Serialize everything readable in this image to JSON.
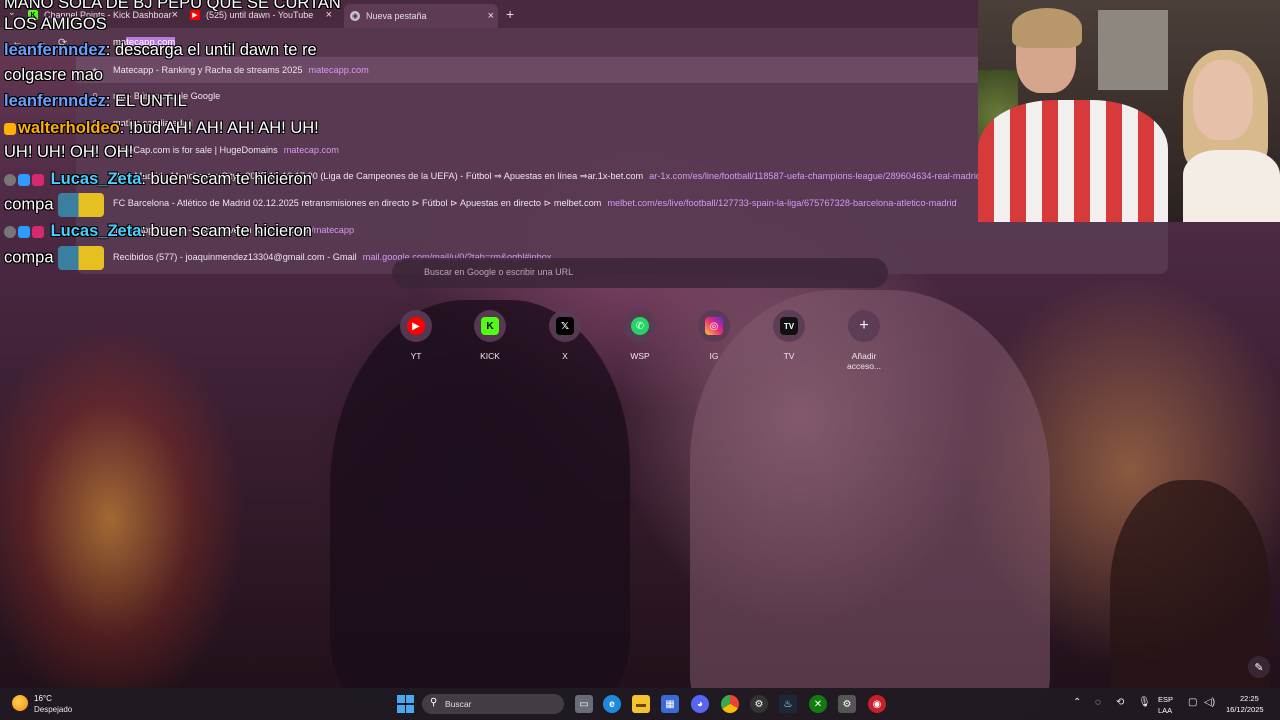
{
  "browser": {
    "tabs": [
      {
        "title": "Channel Points - Kick Dashboar",
        "favicon": "kick-icon",
        "active": false
      },
      {
        "title": "(525) until dawn - YouTube",
        "favicon": "youtube-icon",
        "active": false
      },
      {
        "title": "Nueva pestaña",
        "favicon": "chrome-icon",
        "active": true
      }
    ],
    "new_tab_symbol": "+",
    "omnibox": {
      "typed": "ma",
      "autocomplete": "tecapp.com"
    }
  },
  "suggestions": [
    {
      "icon": "star-icon",
      "title": "Matecapp - Ranking y Racha de streams 2025",
      "url": "matecapp.com"
    },
    {
      "icon": "search-icon",
      "title": "ma - Búsqueda de Google",
      "url": ""
    },
    {
      "icon": "search-icon",
      "title": "matias candia edad",
      "url": ""
    },
    {
      "icon": "globe-icon",
      "title": "MateCap.com is for sale | HugeDomains",
      "url": "matecap.com"
    },
    {
      "icon": "globe-icon",
      "title": "Real Madrid - Manchester City - 2025-12-10 17:00 (Liga de Campeones de la UEFA) - Fútbol ⇒ Apuestas en línea ⇒ar.1x-bet.com",
      "url": "ar-1x.com/es/line/football/118587-uefa-champions-league/289604634-real-madrid"
    },
    {
      "icon": "globe-icon",
      "title": "FC Barcelona - Atlético de Madrid 02.12.2025 retransmisiones en directo ⊳ Fútbol ⊳ Apuestas en directo ⊳ melbet.com",
      "url": "melbet.com/es/live/football/127733-spain-la-liga/675767328-barcelona-atletico-madrid"
    },
    {
      "icon": "kick-icon",
      "title": "matecapp Stream - Watch Live on Kick",
      "url": "kick.com/matecapp"
    },
    {
      "icon": "gmail-icon",
      "title": "Recibidos (577) - joaquinmendez13304@gmail.com - Gmail",
      "url": "mail.google.com/mail/u/0/?tab=rm&ogbl#inbox"
    }
  ],
  "ntp": {
    "search_placeholder": "Buscar en Google o escribir una URL",
    "shortcuts": [
      {
        "label": "YT",
        "icon": "youtube-icon",
        "color": "#ff0000",
        "glyph": "▶"
      },
      {
        "label": "KICK",
        "icon": "kick-icon",
        "color": "#53fc18",
        "glyph": "K"
      },
      {
        "label": "X",
        "icon": "x-icon",
        "color": "#000000",
        "glyph": "𝕏"
      },
      {
        "label": "WSP",
        "icon": "whatsapp-icon",
        "color": "#25d366",
        "glyph": "✆"
      },
      {
        "label": "IG",
        "icon": "instagram-icon",
        "color": "#d62976",
        "glyph": "◎"
      },
      {
        "label": "TV",
        "icon": "twitch-icon",
        "color": "#111111",
        "glyph": "TV"
      },
      {
        "label": "Añadir acceso...",
        "icon": "add-icon",
        "color": "",
        "glyph": "+"
      }
    ]
  },
  "stream_overlay": {
    "chat": [
      {
        "user": "",
        "text": "MANO SOLA DE BJ PEPU QUE SE CURTAN",
        "user_color": "#ffffff"
      },
      {
        "user": "",
        "text": "LOS AMIGOS",
        "user_color": "#ffffff"
      },
      {
        "user": "leanfernndez",
        "text": ": descarga el until dawn te re",
        "user_color": "#6aa0ff"
      },
      {
        "user": "",
        "text": "colgasre mao",
        "user_color": "#ffffff"
      },
      {
        "user": "leanfernndez",
        "text": ": EL UNTIL",
        "user_color": "#6aa0ff"
      },
      {
        "user": "walterholdeo",
        "text": ": !bud AH! AH! AH! AH! UH!",
        "user_color": "#ffb000"
      },
      {
        "user": "",
        "text": "UH! UH! OH! OH!",
        "user_color": "#ffffff"
      },
      {
        "user": "Lucas_Zeta",
        "text": ": buen scam te hicieron",
        "user_color": "#4ad0ff"
      },
      {
        "user": "",
        "text": "compa",
        "user_color": "#ffffff"
      },
      {
        "user": "Lucas_Zeta",
        "text": ": buen scam te hicieron",
        "user_color": "#4ad0ff"
      },
      {
        "user": "",
        "text": "compa",
        "user_color": "#ffffff"
      }
    ]
  },
  "taskbar": {
    "weather_temp": "16°C",
    "weather_desc": "Despejado",
    "search_label": "Buscar",
    "lang_top": "ESP",
    "lang_bottom": "LAA",
    "time": "22:25",
    "date": "16/12/2025"
  }
}
